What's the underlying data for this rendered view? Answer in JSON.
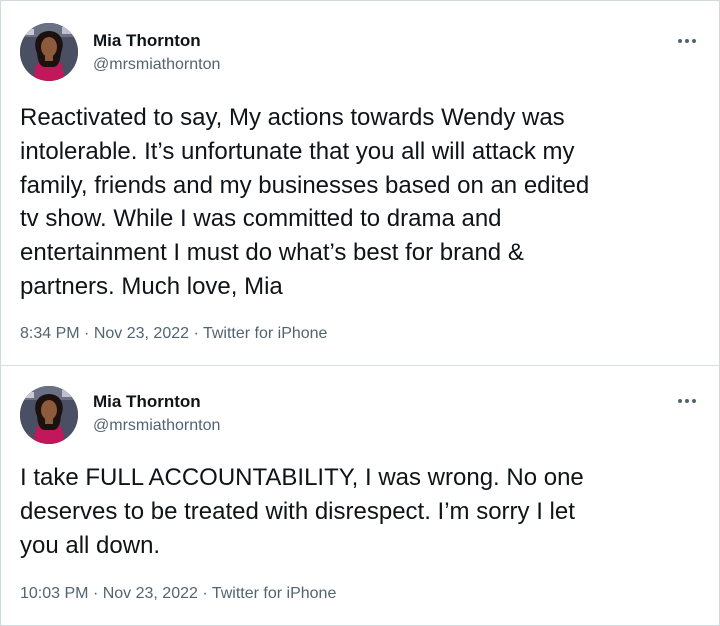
{
  "tweets": [
    {
      "name": "Mia Thornton",
      "handle": "@mrsmiathornton",
      "more_icon": "more-horizontal-icon",
      "text": "Reactivated to say, My actions towards Wendy was\nintolerable.  It’s unfortunate that you all will attack my\nfamily, friends and my businesses based on an edited\ntv show.  While I was committed to drama and\nentertainment I must do what’s best for brand &\npartners.  Much love, Mia",
      "time": "8:34 PM",
      "date": "Nov 23, 2022",
      "source": "Twitter for iPhone",
      "separator": "·"
    },
    {
      "name": "Mia Thornton",
      "handle": "@mrsmiathornton",
      "more_icon": "more-horizontal-icon",
      "text": "I take FULL ACCOUNTABILITY, I was wrong.  No one\ndeserves to be treated with disrespect.  I’m sorry I let\nyou all down.",
      "time": "10:03 PM",
      "date": "Nov 23, 2022",
      "source": "Twitter for iPhone",
      "separator": "·"
    }
  ],
  "colors": {
    "text_primary": "#0f1419",
    "text_secondary": "#536471",
    "border": "#cfd9de"
  }
}
